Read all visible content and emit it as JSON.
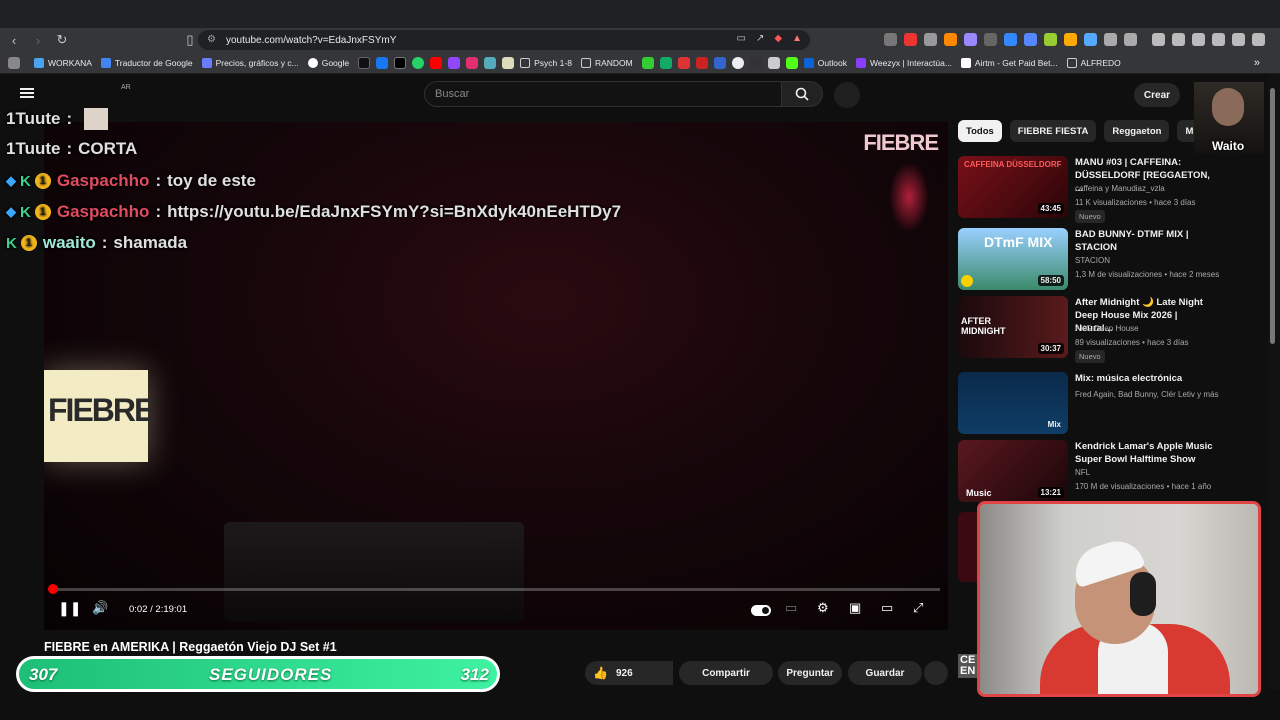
{
  "browser": {
    "url": "youtube.com/watch?v=EdaJnxFSYmY",
    "bookmarks": [
      "WORKANA",
      "Traductor de Google",
      "Precios, gráficos y c...",
      "Google",
      "Psych 1-8",
      "RANDOM",
      "Outlook",
      "Weezyx | Interactúa...",
      "Airtm - Get Paid Bet...",
      "ALFREDO"
    ]
  },
  "header": {
    "region": "AR",
    "search_placeholder": "Buscar",
    "create_label": "Crear"
  },
  "chat": [
    {
      "user": "1Tuute",
      "sep": ":",
      "msg": ""
    },
    {
      "user": "1Tuute",
      "sep": ":",
      "msg": "CORTA"
    },
    {
      "user": "Gaspachho",
      "sep": ":",
      "msg": "toy de este"
    },
    {
      "user": "Gaspachho",
      "sep": ":",
      "msg": "https://youtu.be/EdaJnxFSYmY?si=BnXdyk40nEeHTDy7"
    },
    {
      "user": "waaito",
      "sep": ":",
      "msg": "shamada"
    }
  ],
  "player": {
    "time": "0:02 / 2:19:01",
    "progress_fraction": 0.0002,
    "overlay_logo": "FIEBRE",
    "cube_text": "FIEBRE"
  },
  "video": {
    "title": "FIEBRE en AMERIKA | Reggaetón Viejo DJ Set #1",
    "likes": "926",
    "share": "Compartir",
    "ask": "Preguntar",
    "save": "Guardar"
  },
  "followers": {
    "current": "307",
    "label": "SEGUIDORES",
    "goal": "312"
  },
  "chips": [
    "Todos",
    "FIEBRE FIESTA",
    "Reggaeton",
    "Músic"
  ],
  "recommendations": [
    {
      "title": "MANU #03 | CAFFEINA: DÜSSELDORF [REGGAETON, ...",
      "channel": "caffeina y Manudiaz_vzla",
      "meta": "11 K visualizaciones • hace 3 días",
      "duration": "43:45",
      "badge": "Nuevo",
      "thumb_text": "CAFFEINA DÜSSELDORF",
      "color": "#7a1018"
    },
    {
      "title": "BAD BUNNY- DTMF MIX | STACION",
      "channel": "STACION",
      "meta": "1,3 M de visualizaciones • hace 2 meses",
      "duration": "58:50",
      "badge": "",
      "thumb_text": "DTmF MIX",
      "color": "#3b8a6a"
    },
    {
      "title": "After Midnight 🌙 Late Night Deep House Mix 2026 | Neural...",
      "channel": "AKG Deep House",
      "meta": "89 visualizaciones • hace 3 días",
      "duration": "30:37",
      "badge": "Nuevo",
      "thumb_text": "AFTER MIDNIGHT",
      "color": "#3a1216"
    },
    {
      "title": "Mix: música electrónica",
      "channel": "Fred Again, Bad Bunny, Clér Letiv y más",
      "meta": "",
      "duration": "Mix",
      "badge": "",
      "thumb_text": "",
      "color": "#0f3d66"
    },
    {
      "title": "Kendrick Lamar's Apple Music Super Bowl Halftime Show",
      "channel": "NFL",
      "meta": "170 M de visualizaciones • hace 1 año",
      "duration": "13:21",
      "badge": "",
      "thumb_text": "Music",
      "color": "#5a1820"
    }
  ],
  "facecam_label": "Waito",
  "partial_text": "CE EN"
}
